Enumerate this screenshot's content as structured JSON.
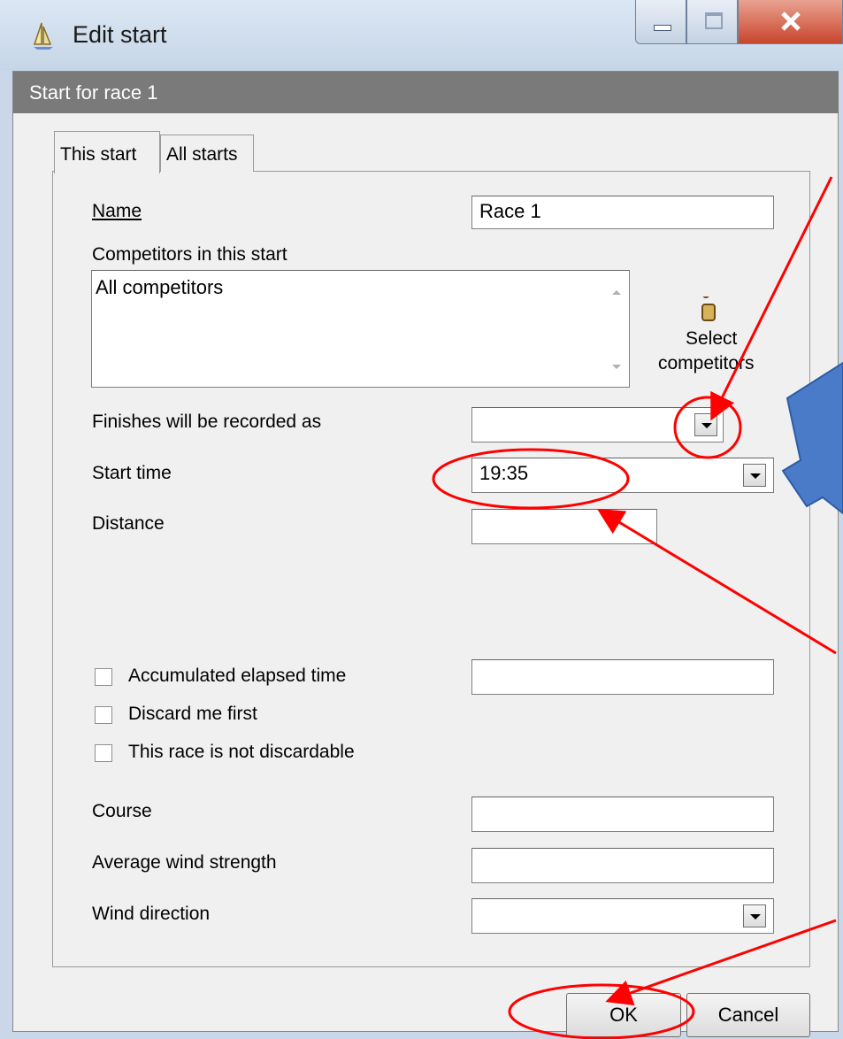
{
  "window": {
    "title": "Edit start"
  },
  "header": {
    "text": "Start for race 1"
  },
  "tabs": [
    {
      "label": "This start"
    },
    {
      "label": "All starts"
    }
  ],
  "form": {
    "name_label": "Name",
    "name_value": "Race 1",
    "competitors_label": "Competitors in this start",
    "competitors_value": "All competitors",
    "select_competitors_line1": "Select",
    "select_competitors_line2": "competitors",
    "finishes_label": "Finishes will be recorded as",
    "finishes_value": "",
    "start_time_label": "Start time",
    "start_time_value": "19:35",
    "distance_label": "Distance",
    "distance_value": "",
    "accumulated_label": "Accumulated elapsed time",
    "accumulated_value": "",
    "discard_first_label": "Discard me first",
    "not_discardable_label": "This race is not discardable",
    "course_label": "Course",
    "course_value": "",
    "wind_strength_label": "Average wind strength",
    "wind_strength_value": "",
    "wind_direction_label": "Wind direction",
    "wind_direction_value": ""
  },
  "buttons": {
    "ok": "OK",
    "cancel": "Cancel"
  },
  "annotation_colors": {
    "arrow": "#ff0000",
    "block_arrow": "#4a7bc8"
  }
}
